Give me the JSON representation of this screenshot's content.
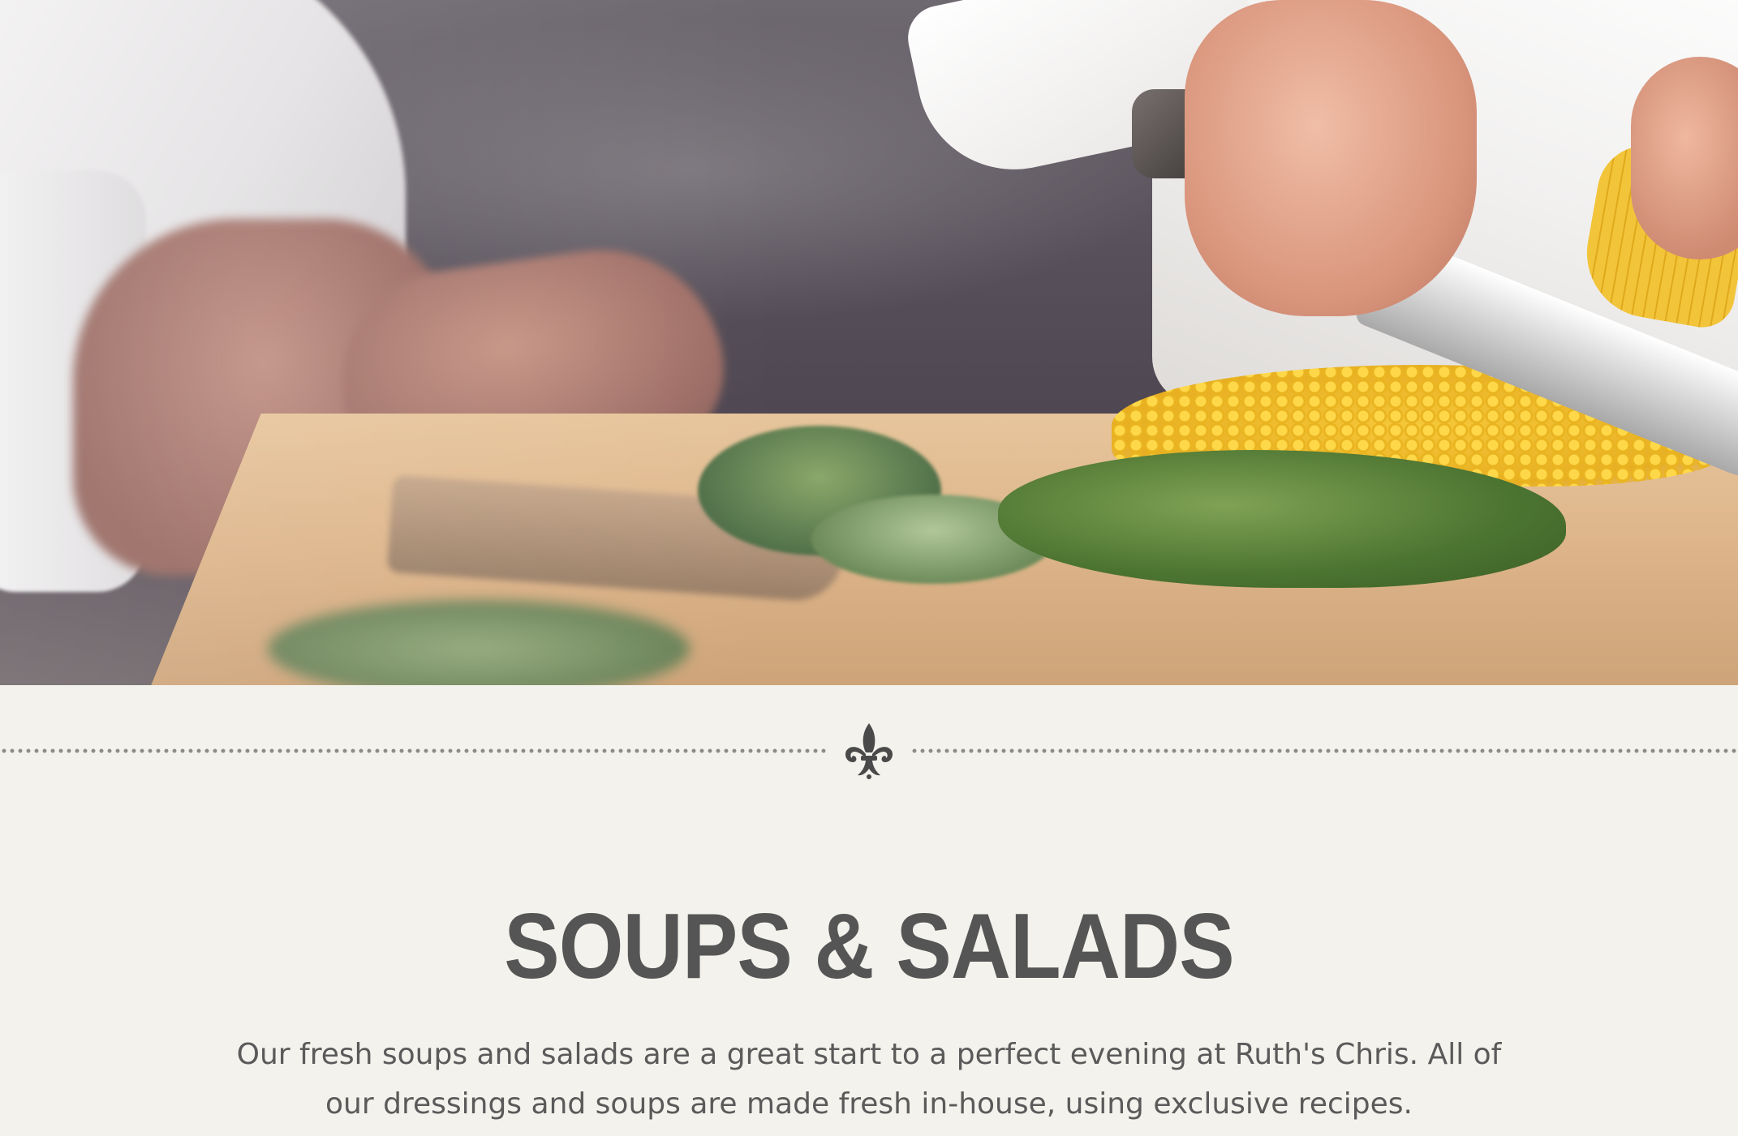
{
  "hero": {
    "image_description_icon": "chefs-cutting-board-photo-icon"
  },
  "divider": {
    "icon": "fleur-de-lis-icon",
    "dot_color": "#8f8b86"
  },
  "section": {
    "title": "SOUPS & SALADS",
    "description": "Our fresh soups and salads are a great start to a perfect evening at Ruth's Chris. All of our dressings and soups are made fresh in-house, using exclusive recipes."
  },
  "colors": {
    "background": "#f3f2ec",
    "title": "#555555",
    "body_text": "#5a5a5a"
  }
}
